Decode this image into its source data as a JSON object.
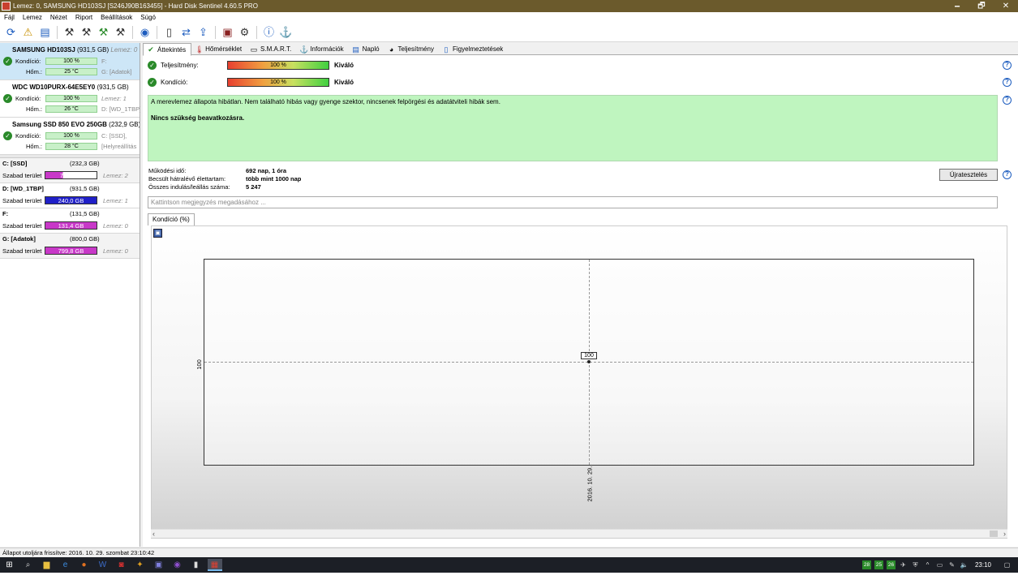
{
  "window": {
    "title": "Lemez: 0, SAMSUNG HD103SJ [S246J90B163455]  -  Hard Disk Sentinel 4.60.5 PRO",
    "minimize": "🗕",
    "maximize": "🗗",
    "close": "✕"
  },
  "menu": [
    "Fájl",
    "Lemez",
    "Nézet",
    "Riport",
    "Beállítások",
    "Súgó"
  ],
  "disks": [
    {
      "name": "SAMSUNG HD103SJ",
      "size": "(931,5 GB)",
      "disk_label": "Lemez: 0",
      "cond_label": "Kondíció:",
      "cond": "100 %",
      "temp_label": "Hőm.:",
      "temp": "25 °C",
      "drives1": "F:",
      "drives2": "G: [Adatok]"
    },
    {
      "name": "WDC WD10PURX-64E5EY0",
      "size": "(931,5 GB)",
      "disk_label": "",
      "cond_label": "Kondíció:",
      "cond": "100 %",
      "temp_label": "Hőm.:",
      "temp": "26 °C",
      "drives1": "Lemez: 1",
      "drives2": "D: [WD_1TBP]"
    },
    {
      "name": "Samsung SSD 850 EVO 250GB",
      "size": "(232,9 GB)",
      "disk_label": "Le",
      "cond_label": "Kondíció:",
      "cond": "100 %",
      "temp_label": "Hőm.:",
      "temp": "28 °C",
      "drives1": "C: [SSD],",
      "drives2": "[Helyreállítás"
    }
  ],
  "volumes": [
    {
      "name": "C: [SSD]",
      "size": "(232,3 GB)",
      "free_label": "Szabad terület",
      "free": "79,0 GB",
      "disk": "Lemez: 2",
      "color": "#c838c8",
      "fill": 0.34
    },
    {
      "name": "D: [WD_1TBP]",
      "size": "(931,5 GB)",
      "free_label": "Szabad terület",
      "free": "240,0 GB",
      "disk": "Lemez: 1",
      "color": "#2020c8",
      "fill": 1.0
    },
    {
      "name": "F:",
      "size": "(131,5 GB)",
      "free_label": "Szabad terület",
      "free": "131,4 GB",
      "disk": "Lemez: 0",
      "color": "#c838c8",
      "fill": 1.0
    },
    {
      "name": "G: [Adatok]",
      "size": "(800,0 GB)",
      "free_label": "Szabad terület",
      "free": "799,8 GB",
      "disk": "Lemez: 0",
      "color": "#c838c8",
      "fill": 1.0
    }
  ],
  "tabs": [
    "Áttekintés",
    "Hőmérséklet",
    "S.M.A.R.T.",
    "Információk",
    "Napló",
    "Teljesítmény",
    "Figyelmeztetések"
  ],
  "health": {
    "perf_label": "Teljesítmény:",
    "perf_value": "100 %",
    "perf_text": "Kiváló",
    "cond_label": "Kondíció:",
    "cond_value": "100 %",
    "cond_text": "Kiváló"
  },
  "status_text": "A merevlemez állapota hibátlan. Nem található hibás vagy gyenge szektor, nincsenek felpörgési és adatátviteli hibák sem.",
  "status_action": "Nincs szükség beavatkozásra.",
  "stats": {
    "uptime_label": "Működési idő:",
    "uptime": "692 nap, 1 óra",
    "life_label": "Becsült hátralévő élettartam:",
    "life": "több mint 1000 nap",
    "starts_label": "Összes indulás/leállás száma:",
    "starts": "5 247"
  },
  "reset_button": "Újratesztelés",
  "note_placeholder": "Kattintson megjegyzés megadásához ...",
  "chart_tab": "Kondíció  (%)",
  "chart_data": {
    "type": "line",
    "x": [
      "2016. 10. 29."
    ],
    "series": [
      {
        "values": [
          100
        ]
      }
    ],
    "title": "",
    "ylabel": "",
    "xlabel": "",
    "point_labels": [
      "100"
    ],
    "y_ticks": [
      "100"
    ],
    "x_ticks": [
      "2016. 10. 29."
    ]
  },
  "statusbar": "Állapot utoljára frissítve: 2016. 10. 29. szombat 23:10:42",
  "tray": {
    "clock": "23:10",
    "n1": "28",
    "n2": "25",
    "n3": "26"
  }
}
